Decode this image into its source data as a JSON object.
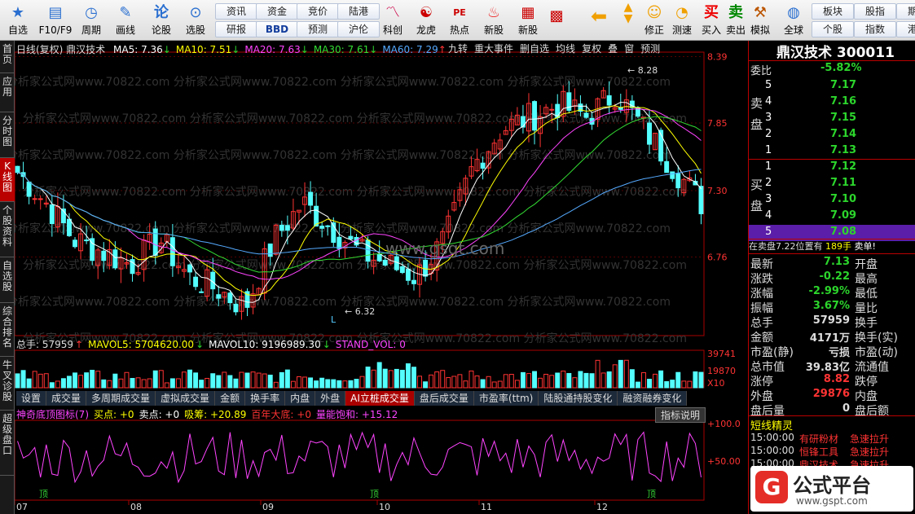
{
  "toolbar": {
    "items": [
      {
        "label": "自选",
        "icon": "star-icon"
      },
      {
        "label": "F10/F9",
        "icon": "f10-icon"
      },
      {
        "label": "周期",
        "icon": "clock-icon"
      },
      {
        "label": "画线",
        "icon": "pencil-icon"
      },
      {
        "label": "论股",
        "icon": "discuss-icon"
      },
      {
        "label": "选股",
        "icon": "magnify-chart-icon"
      }
    ],
    "buttons_top": [
      "资讯",
      "资金",
      "竞价",
      "陆港"
    ],
    "buttons_bottom": [
      "研报",
      "BBD",
      "预测",
      "沪伦"
    ],
    "items2": [
      {
        "label": "科创"
      },
      {
        "label": "龙虎"
      },
      {
        "label": "热点"
      },
      {
        "label": "新股"
      }
    ],
    "pe_label": "PE",
    "nav": [
      {
        "label": "修正"
      },
      {
        "label": "测速"
      }
    ],
    "trade": [
      {
        "label": "买入",
        "glyph": "买"
      },
      {
        "label": "卖出",
        "glyph": "卖"
      },
      {
        "label": "模拟"
      }
    ],
    "global": "全球",
    "right_top": [
      "板块",
      "股指",
      "期货"
    ],
    "right_bottom": [
      "个股",
      "指数",
      "港股"
    ]
  },
  "sidenav": [
    "首页",
    "应用",
    "分时图",
    "K线图",
    "个股资料",
    "自选股",
    "综合排名",
    "牛叉诊股",
    "超级盘口"
  ],
  "chart": {
    "header_left": "日线(复权) 鼎汉技术",
    "ma": [
      {
        "label": "MA5: 7.36",
        "arrow": "↓",
        "color": "#ffffff"
      },
      {
        "label": "MA10: 7.51",
        "arrow": "↓",
        "color": "#ffff00"
      },
      {
        "label": "MA20: 7.63",
        "arrow": "↓",
        "color": "#ff44ff"
      },
      {
        "label": "MA30: 7.61",
        "arrow": "↓",
        "color": "#33dd33"
      },
      {
        "label": "MA60: 7.29",
        "arrow": "↑",
        "color": "#55aaff"
      }
    ],
    "tools": [
      "九转",
      "重大事件",
      "删自选",
      "均线",
      "复权",
      "叠",
      "窗",
      "预测"
    ],
    "price_ticks": [
      "8.39",
      "7.85",
      "7.30",
      "6.76"
    ],
    "high_label": "8.28",
    "low_label": "6.32",
    "low_marker": "L",
    "watermark": "www.gsgt.com",
    "wm_text": "分析家公式网www.70822.com",
    "vol_header": [
      {
        "label": "总手: 57959",
        "arrow": "↑",
        "color": "#dddddd"
      },
      {
        "label": "MAVOL5: 5704620.00",
        "arrow": "↓",
        "color": "#ffff00"
      },
      {
        "label": "MAVOL10: 9196989.30",
        "arrow": "↓",
        "color": "#ffffff"
      },
      {
        "label": "STAND_VOL: 0",
        "arrow": "",
        "color": "#ff44ff"
      }
    ],
    "vol_ticks": [
      "39741",
      "19870",
      "X10"
    ],
    "tabs": [
      "设置",
      "成交量",
      "多周期成交量",
      "虚拟成交量",
      "金额",
      "换手率",
      "内盘",
      "外盘",
      "AI立桩成交量",
      "盘后成交量",
      "市盈率(ttm)",
      "陆股通持股变化",
      "融资融券变化"
    ],
    "active_tab": "AI立桩成交量",
    "ind_header": [
      {
        "label": "神奇底顶图标(7)",
        "color": "#ff44ff"
      },
      {
        "label": "买点: +0",
        "color": "#ffff00"
      },
      {
        "label": "卖点: +0",
        "color": "#ffffff"
      },
      {
        "label": "吸筹: +20.89",
        "color": "#ffff00"
      },
      {
        "label": "百年大底: +0",
        "color": "#ff3333"
      },
      {
        "label": "量能饱和: +15.12",
        "color": "#ff44ff"
      }
    ],
    "ind_button": "指标说明",
    "ind_ticks": [
      "+100.0",
      "+50.00"
    ],
    "ind_marks": [
      "顶",
      "顶",
      "顶"
    ],
    "months": [
      "07",
      "08",
      "09",
      "10",
      "11",
      "12"
    ]
  },
  "chart_data": {
    "type": "candlestick",
    "ylim": [
      6.2,
      8.4
    ],
    "ma_last": {
      "MA5": 7.36,
      "MA10": 7.51,
      "MA20": 7.63,
      "MA30": 7.61,
      "MA60": 7.29
    },
    "high": 8.28,
    "low": 6.32
  },
  "quote": {
    "name": "鼎汉技术",
    "code": "300011",
    "weibi_label": "委比",
    "weibi": "-5.82%",
    "sell_label": "卖盘",
    "buy_label": "买盘",
    "sell": [
      {
        "n": "5",
        "p": "7.17"
      },
      {
        "n": "4",
        "p": "7.16"
      },
      {
        "n": "3",
        "p": "7.15"
      },
      {
        "n": "2",
        "p": "7.14"
      },
      {
        "n": "1",
        "p": "7.13"
      }
    ],
    "buy": [
      {
        "n": "1",
        "p": "7.12"
      },
      {
        "n": "2",
        "p": "7.11"
      },
      {
        "n": "3",
        "p": "7.10"
      },
      {
        "n": "4",
        "p": "7.09"
      },
      {
        "n": "5",
        "p": "7.08"
      }
    ],
    "notice": "在卖盘7.22位置有",
    "notice_vol": "189手",
    "notice_tail": "卖单!",
    "stats": [
      {
        "l": "最新",
        "v": "7.13",
        "r": "开盘"
      },
      {
        "l": "涨跌",
        "v": "-0.22",
        "r": "最高"
      },
      {
        "l": "涨幅",
        "v": "-2.99%",
        "r": "最低"
      },
      {
        "l": "振幅",
        "v": "3.67%",
        "r": "量比"
      },
      {
        "l": "总手",
        "v": "57959",
        "r": "换手"
      },
      {
        "l": "金额",
        "v": "4171万",
        "r": "换手(实)"
      },
      {
        "l": "市盈(静)",
        "v": "亏损",
        "r": "市盈(动)"
      },
      {
        "l": "总市值",
        "v": "39.83亿",
        "r": "流通值"
      },
      {
        "l": "涨停",
        "v": "8.82",
        "r": "跌停"
      },
      {
        "l": "外盘",
        "v": "29876",
        "r": "内盘"
      },
      {
        "l": "盘后量",
        "v": "0",
        "r": "盘后额"
      }
    ],
    "elf_title": "短线精灵",
    "elf": [
      {
        "t": "15:00:00",
        "n": "有研粉材",
        "e": "急速拉升"
      },
      {
        "t": "15:00:00",
        "n": "恒锋工具",
        "e": "急速拉升"
      },
      {
        "t": "15:00:00",
        "n": "鼎汉技术",
        "e": "急速拉升"
      }
    ],
    "brand": "公式平台",
    "brand_url": "www.gspt.com"
  }
}
